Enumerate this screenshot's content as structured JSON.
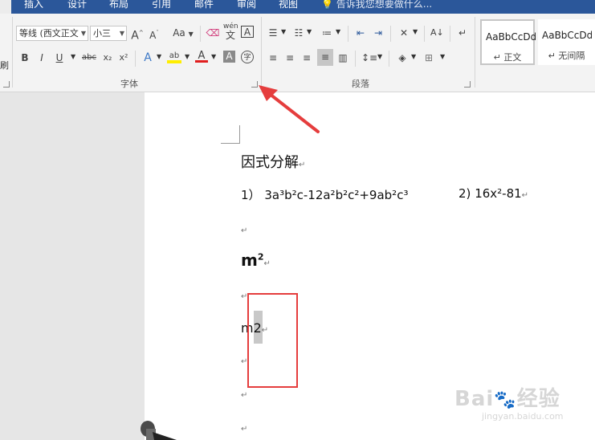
{
  "tabs": [
    "插入",
    "设计",
    "布局",
    "引用",
    "邮件",
    "审阅",
    "视图"
  ],
  "tell_me": "告诉我您想要做什么...",
  "font": {
    "name": "等线 (西文正文",
    "size": "小三",
    "bold": "B",
    "italic": "I",
    "underline": "U",
    "strike": "abc",
    "subscript": "x₂",
    "superscript": "x²",
    "grow": "A",
    "shrink": "A",
    "case": "Aa",
    "phonetic": "wén",
    "border_char": "A",
    "effects": "A",
    "highlight": "ab",
    "color": "A",
    "shade": "A",
    "enclose": "字",
    "group_label": "字体"
  },
  "paragraph": {
    "group_label": "段落"
  },
  "styles": [
    {
      "sample": "AaBbCcDd",
      "name": "↵ 正文"
    },
    {
      "sample": "AaBbCcDd",
      "name": "↵ 无间隔"
    }
  ],
  "document": {
    "heading": "因式分解",
    "problem1_label": "1）",
    "problem1": "3a³b²c-12a²b²c²+9ab²c³",
    "problem2_label": "2)",
    "problem2": "16x²-81",
    "m_base": "m",
    "m_sup": "2",
    "m2_plain": "m2",
    "para_mark": "↵"
  },
  "colors": {
    "accent": "#2b579a",
    "annotation": "#e53d3d",
    "highlight": "#ffee00",
    "font_color": "#e01e1e"
  }
}
